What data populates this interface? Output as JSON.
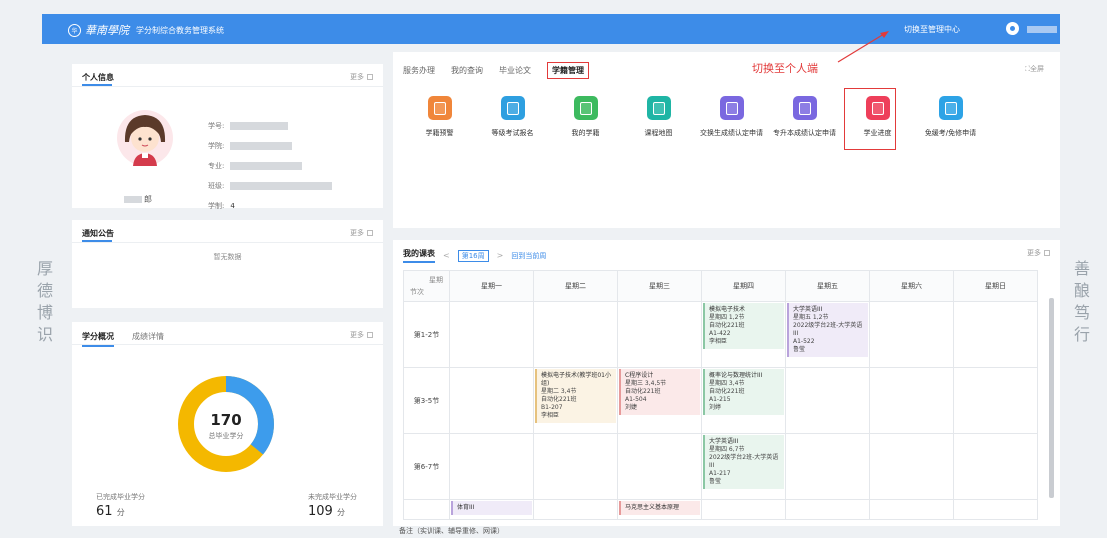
{
  "header": {
    "logo_mark": "华",
    "brand": "華南學院",
    "system_name": "学分制综合教务管理系统",
    "switch_link": "切换至管理中心"
  },
  "motto_left": [
    "厚",
    "德",
    "博",
    "识"
  ],
  "motto_right": [
    "善",
    "酿",
    "笃",
    "行"
  ],
  "personal": {
    "title": "个人信息",
    "more": "更多",
    "fields": [
      {
        "label": "学号:"
      },
      {
        "label": "学院:"
      },
      {
        "label": "专业:"
      },
      {
        "label": "班级:"
      },
      {
        "label": "学制:",
        "value": "4"
      }
    ],
    "name_suffix": "郎"
  },
  "notice": {
    "title": "通知公告",
    "more": "更多",
    "empty": "暂无数据"
  },
  "credits": {
    "tabs": [
      "学分概况",
      "成绩详情"
    ],
    "more": "更多",
    "total": "170",
    "total_label": "总毕业学分",
    "done_label": "已完成毕业学分",
    "done_value": "61",
    "todo_label": "未完成毕业学分",
    "todo_value": "109",
    "unit": "分",
    "colors": {
      "done": "#3d9cec",
      "todo": "#f4b800"
    },
    "done_fraction": 0.359
  },
  "main": {
    "tabs": [
      "服务办理",
      "我的查询",
      "毕业论文",
      "学籍管理"
    ],
    "fullscreen": "全屏",
    "annotation": "切换至个人端",
    "apps": [
      {
        "label": "学籍预警",
        "color": "#f0863a"
      },
      {
        "label": "等级考试报名",
        "color": "#2e9fe0"
      },
      {
        "label": "我的学籍",
        "color": "#3dba5f"
      },
      {
        "label": "课程地图",
        "color": "#1fb5a5"
      },
      {
        "label": "交换生成绩认定申请",
        "color": "#7a68e0"
      },
      {
        "label": "专升本成绩认定申请",
        "color": "#7a68e0"
      },
      {
        "label": "学业进度",
        "color": "#ee3f5a"
      },
      {
        "label": "免缓考/免修申请",
        "color": "#2da3e6"
      }
    ]
  },
  "schedule": {
    "title": "我的课表",
    "week": "第16周",
    "back": "回到当前周",
    "more": "更多",
    "corner_day": "星期",
    "corner_slot": "节次",
    "days": [
      "星期一",
      "星期二",
      "星期三",
      "星期四",
      "星期五",
      "星期六",
      "星期日"
    ],
    "slots": [
      "第1-2节",
      "第3-5节",
      "第6-7节"
    ],
    "courses": {
      "r0d3": {
        "cls": "cg",
        "name": "模拟电子技术",
        "lines": [
          "星期四 1,2节",
          "自动化221班",
          "A1-422",
          "李相臣"
        ]
      },
      "r0d4": {
        "cls": "cp",
        "name": "大学英语III",
        "lines": [
          "星期五 1,2节",
          "2022级学台2班-大学英语III",
          "A1-522",
          "鲁莹"
        ]
      },
      "r1d1": {
        "cls": "cy",
        "name": "模拟电子技术(教学班01小组)",
        "lines": [
          "星期二 3,4节",
          "自动化221班",
          "B1-207",
          "李相臣"
        ]
      },
      "r1d2": {
        "cls": "cr",
        "name": "C程序设计",
        "lines": [
          "星期三 3,4,5节",
          "自动化221班",
          "A1-504",
          "刘婕"
        ]
      },
      "r1d3": {
        "cls": "cg",
        "name": "概率论与数理统计III",
        "lines": [
          "星期四 3,4节",
          "自动化221班",
          "A1-215",
          "刘婷"
        ]
      },
      "r2d3": {
        "cls": "cg",
        "name": "大学英语III",
        "lines": [
          "星期四 6,7节",
          "2022级学台2班-大学英语III",
          "A1-217",
          "鲁莹"
        ]
      }
    },
    "partial_row": {
      "d0": "体育III",
      "d2": "马克思主义基本原理"
    },
    "footnote": "备注（实训课、辅导重修、网课）"
  }
}
